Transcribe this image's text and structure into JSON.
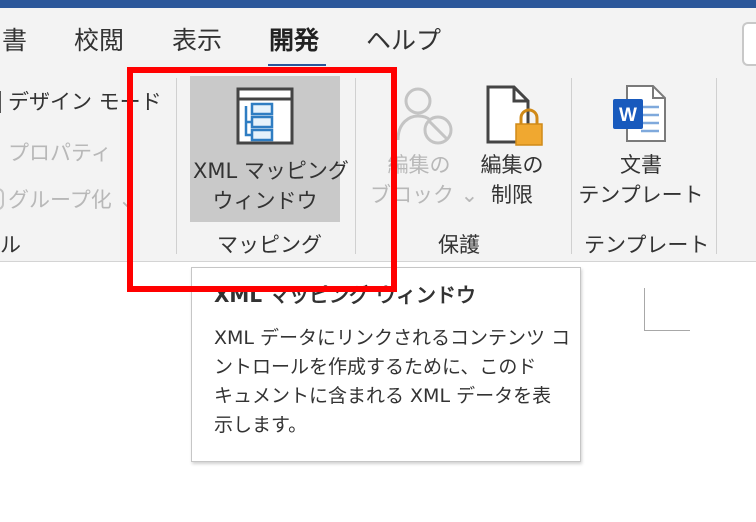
{
  "tabs": [
    {
      "label": "書"
    },
    {
      "label": "校閲"
    },
    {
      "label": "表示"
    },
    {
      "label": "開発"
    },
    {
      "label": "ヘルプ"
    }
  ],
  "active_tab": "開発",
  "controls_group": {
    "design_mode": "デザイン モード",
    "properties": "プロパティ",
    "group": "グループ化 ⌄",
    "label_fragment": "ル"
  },
  "mapping_group": {
    "xml_button_line1": "XML マッピング",
    "xml_button_line2": "ウィンドウ",
    "label": "マッピング"
  },
  "protect_group": {
    "block_authors_line1": "編集の",
    "block_authors_line2": "ブロック ⌄",
    "restrict_editing_line1": "編集の",
    "restrict_editing_line2": "制限",
    "label": "保護"
  },
  "templates_group": {
    "document_template_line1": "文書",
    "document_template_line2": "テンプレート",
    "label": "テンプレート"
  },
  "tooltip": {
    "title": "XML マッピング ウィンドウ",
    "lines": [
      "XML データにリンクされるコンテンツ コ",
      "ントロールを作成するために、このド",
      "キュメントに含まれる XML データを表",
      "示します。"
    ]
  },
  "colors": {
    "accent": "#2b579a",
    "highlight": "#ff0000",
    "button_pressed": "#c9c9c9",
    "ribbon_bg": "#f3f3f3",
    "lock": "#f0a830",
    "word_blue": "#185abd"
  },
  "icons": {
    "xml_mapping": "xml-mapping-pane-icon",
    "block_authors": "block-authors-icon",
    "restrict_editing": "document-lock-icon",
    "document_template": "word-document-icon"
  }
}
